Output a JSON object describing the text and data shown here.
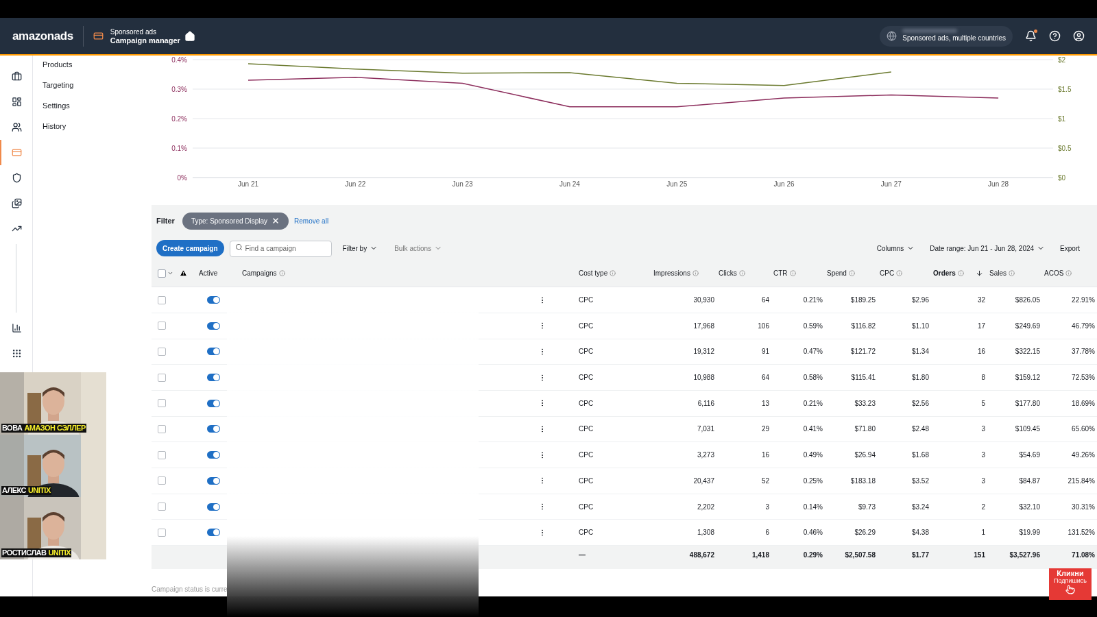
{
  "header": {
    "logo": "amazonads",
    "product": "Sponsored ads",
    "title": "Campaign manager",
    "account": "Sponsored ads, multiple countries",
    "notification_dot": true
  },
  "rail": [
    {
      "kind": "briefcase",
      "selected": false
    },
    {
      "kind": "dashboard",
      "selected": false
    },
    {
      "kind": "people",
      "selected": false
    },
    {
      "kind": "card",
      "selected": true
    },
    {
      "kind": "shield",
      "selected": false
    },
    {
      "kind": "images",
      "selected": false
    },
    {
      "kind": "trend",
      "selected": false
    },
    {
      "kind": "bars",
      "selected": false
    },
    {
      "kind": "apps",
      "selected": false
    }
  ],
  "subnav": [
    "Products",
    "Targeting",
    "Settings",
    "History"
  ],
  "chart_data": {
    "type": "line",
    "categories": [
      "Jun 21",
      "Jun 22",
      "Jun 23",
      "Jun 24",
      "Jun 25",
      "Jun 26",
      "Jun 27",
      "Jun 28"
    ],
    "series": [
      {
        "color": "#6b7a2f",
        "axis": "y2",
        "values": [
          1.93,
          1.84,
          1.77,
          1.78,
          1.6,
          1.56,
          1.79,
          null
        ]
      },
      {
        "color": "#8c2d5c",
        "values": [
          0.33,
          0.34,
          0.32,
          0.24,
          0.24,
          0.27,
          0.28,
          0.27
        ]
      }
    ],
    "ylim": [
      0,
      0.4
    ],
    "y2lim": [
      0,
      2
    ],
    "grid": true,
    "y2ticks": [
      {
        "value": 0,
        "label": "$0"
      },
      {
        "value": 0.5,
        "label": "$0.5"
      },
      {
        "value": 1,
        "label": "$1"
      },
      {
        "value": 1.5,
        "label": "$1.5"
      },
      {
        "value": 2,
        "label": "$2"
      }
    ],
    "yticks": [
      {
        "value": 0,
        "label": "0%"
      },
      {
        "value": 0.1,
        "label": "0.1%"
      },
      {
        "value": 0.2,
        "label": "0.2%"
      },
      {
        "value": 0.3,
        "label": "0.3%"
      },
      {
        "value": 0.4,
        "label": "0.4%"
      }
    ]
  },
  "select_all_checked": false,
  "filter": {
    "label": "Filter",
    "chip": "Type: Sponsored Display",
    "remove_all": "Remove all"
  },
  "toolbar": {
    "create": "Create campaign",
    "search_placeholder": "Find a campaign",
    "filter_by": "Filter by",
    "bulk": "Bulk actions",
    "columns": "Columns",
    "date_range": "Date range: Jun 21 - Jun 28, 2024",
    "export": "Export"
  },
  "columns": [
    {
      "label": "Active"
    },
    {
      "label": "Campaigns"
    },
    {
      "label": "Cost type"
    },
    {
      "label": "Impressions"
    },
    {
      "label": "Clicks"
    },
    {
      "label": "CTR"
    },
    {
      "label": "Spend"
    },
    {
      "label": "CPC"
    },
    {
      "label": "Orders",
      "sorted": true
    },
    {
      "label": "Sales"
    },
    {
      "label": "ACOS"
    }
  ],
  "rows": [
    {
      "checked": false,
      "on": true,
      "cells": [
        "CPC",
        "30,930",
        "64",
        "0.21%",
        "$189.25",
        "$2.96",
        "32",
        "$826.05",
        "22.91%"
      ]
    },
    {
      "checked": false,
      "on": true,
      "cells": [
        "CPC",
        "17,968",
        "106",
        "0.59%",
        "$116.82",
        "$1.10",
        "17",
        "$249.69",
        "46.79%"
      ]
    },
    {
      "checked": false,
      "on": true,
      "cells": [
        "CPC",
        "19,312",
        "91",
        "0.47%",
        "$121.72",
        "$1.34",
        "16",
        "$322.15",
        "37.78%"
      ]
    },
    {
      "checked": false,
      "on": true,
      "cells": [
        "CPC",
        "10,988",
        "64",
        "0.58%",
        "$115.41",
        "$1.80",
        "8",
        "$159.12",
        "72.53%"
      ]
    },
    {
      "checked": false,
      "on": true,
      "cells": [
        "CPC",
        "6,116",
        "13",
        "0.21%",
        "$33.23",
        "$2.56",
        "5",
        "$177.80",
        "18.69%"
      ]
    },
    {
      "checked": false,
      "on": true,
      "cells": [
        "CPC",
        "7,031",
        "29",
        "0.41%",
        "$71.80",
        "$2.48",
        "3",
        "$109.45",
        "65.60%"
      ]
    },
    {
      "checked": false,
      "on": true,
      "cells": [
        "CPC",
        "3,273",
        "16",
        "0.49%",
        "$26.94",
        "$1.68",
        "3",
        "$54.69",
        "49.26%"
      ]
    },
    {
      "checked": false,
      "on": true,
      "cells": [
        "CPC",
        "20,437",
        "52",
        "0.25%",
        "$183.18",
        "$3.52",
        "3",
        "$84.87",
        "215.84%"
      ]
    },
    {
      "checked": false,
      "on": true,
      "cells": [
        "CPC",
        "2,202",
        "3",
        "0.14%",
        "$9.73",
        "$3.24",
        "2",
        "$32.10",
        "30.31%"
      ]
    },
    {
      "checked": false,
      "on": true,
      "cells": [
        "CPC",
        "1,308",
        "6",
        "0.46%",
        "$26.29",
        "$4.38",
        "1",
        "$19.99",
        "131.52%"
      ]
    }
  ],
  "totals": [
    "—",
    "488,672",
    "1,418",
    "0.29%",
    "$2,507.58",
    "$1.77",
    "151",
    "$3,527.96",
    "71.08%"
  ],
  "footer_note": "Campaign status is curre",
  "webcams": [
    {
      "name": "ВОВА",
      "tag": "АМАЗОН СЭЛЛЕР"
    },
    {
      "name": "АЛЕКС",
      "tag": "UNITIX"
    },
    {
      "name": "РОСТИСЛАВ",
      "tag": "UNITIX"
    }
  ],
  "subscribe": {
    "title": "Кликни",
    "subtitle": "Подпишись"
  }
}
